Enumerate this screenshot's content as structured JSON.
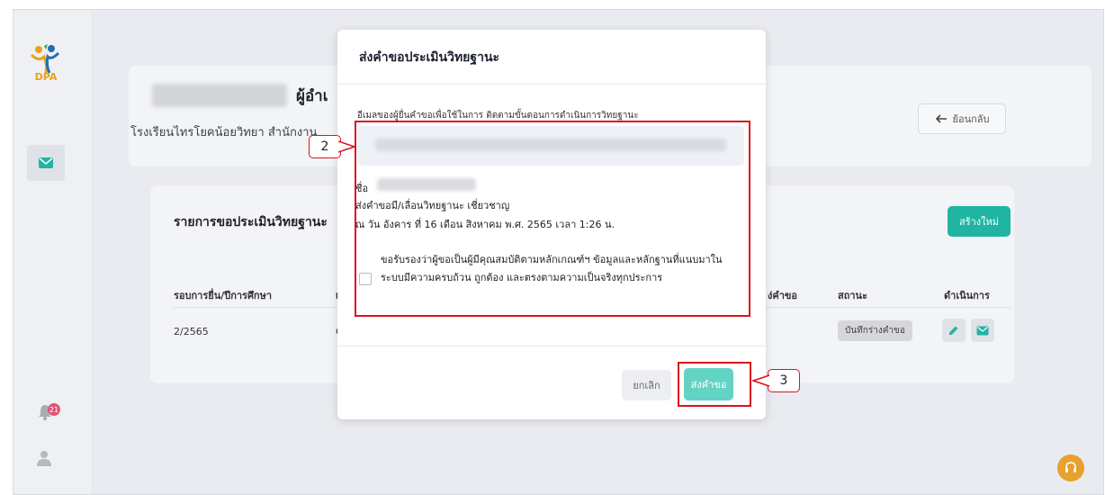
{
  "header": {
    "title": "ผู้อำเ",
    "school": "โรงเรียนไทรโยคน้อยวิทยา สำนักงาน",
    "back_label": "ย้อนกลับ"
  },
  "logo": {
    "text": "DPA"
  },
  "notifications": {
    "count": "21"
  },
  "list": {
    "title": "รายการขอประเมินวิทยฐานะ",
    "new_label": "สร้างใหม่",
    "columns": [
      "รอบการยื่น/ปีการศึกษา",
      "เ",
      "ง่คำขอ",
      "สถานะ",
      "ดำเนินการ"
    ],
    "rows": [
      {
        "round": "2/2565",
        "col2": "C",
        "status": "บันทึกร่างคำขอ"
      }
    ]
  },
  "modal": {
    "title": "ส่งคำขอประเมินวิทยฐานะ",
    "email_label": "อีเมลของผู้ยื่นคำขอเพื่อใช้ในการ ติดตามขั้นตอนการดำเนินการวิทยฐานะ",
    "name_label": "ชื่อ",
    "request_line": "ส่งคำขอมี/เลื่อนวิทยฐานะ เชี่ยวชาญ",
    "date_line": "ณ วัน อังคาร ที่ 16 เดือน สิงหาคม พ.ศ. 2565 เวลา 1:26 น.",
    "certify_text": "ขอรับรองว่าผู้ขอเป็นผู้มีคุณสมบัติตามหลักเกณฑ์ฯ ข้อมูลและหลักฐานที่แนบมาในระบบมีความครบถ้วน ถูกต้อง และตรงตามความเป็นจริงทุกประการ",
    "cancel_label": "ยกเลิก",
    "submit_label": "ส่งคำขอ"
  },
  "annotations": {
    "callout_2": "2",
    "callout_3": "3",
    "highlight_color": "#d8141b"
  },
  "colors": {
    "primary": "#20b5a2",
    "submit_disabled": "#63d4c3",
    "help": "#e7a12c"
  }
}
